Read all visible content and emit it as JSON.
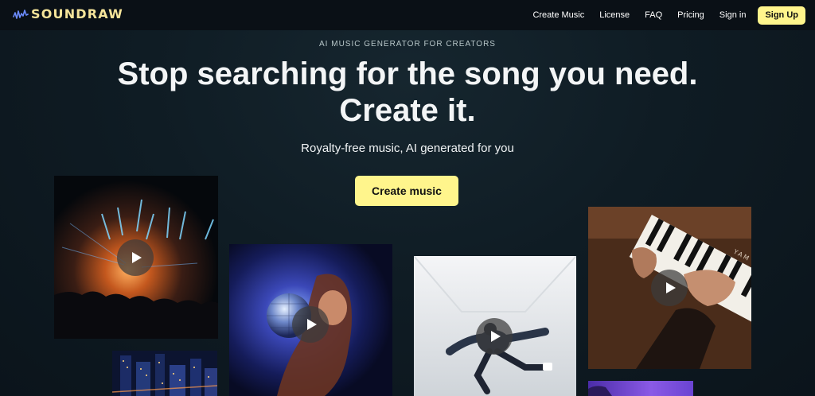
{
  "brand": {
    "name": "SOUNDRAW",
    "accent": "#fff58c"
  },
  "nav": {
    "links": [
      "Create Music",
      "License",
      "FAQ",
      "Pricing",
      "Sign in"
    ],
    "signup_label": "Sign Up"
  },
  "hero": {
    "eyebrow": "AI MUSIC GENERATOR FOR CREATORS",
    "headline_line1": "Stop searching for the song you need.",
    "headline_line2": "Create it.",
    "subtitle": "Royalty-free music, AI generated for you",
    "cta_label": "Create music"
  },
  "tiles": [
    {
      "name": "concert-image",
      "icon": "play-icon"
    },
    {
      "name": "city-night-image",
      "icon": null
    },
    {
      "name": "disco-ball-image",
      "icon": "play-icon"
    },
    {
      "name": "dancer-image",
      "icon": "play-icon"
    },
    {
      "name": "piano-image",
      "icon": "play-icon"
    },
    {
      "name": "purple-sky-image",
      "icon": null
    }
  ],
  "piano_brand_text": "YAM"
}
